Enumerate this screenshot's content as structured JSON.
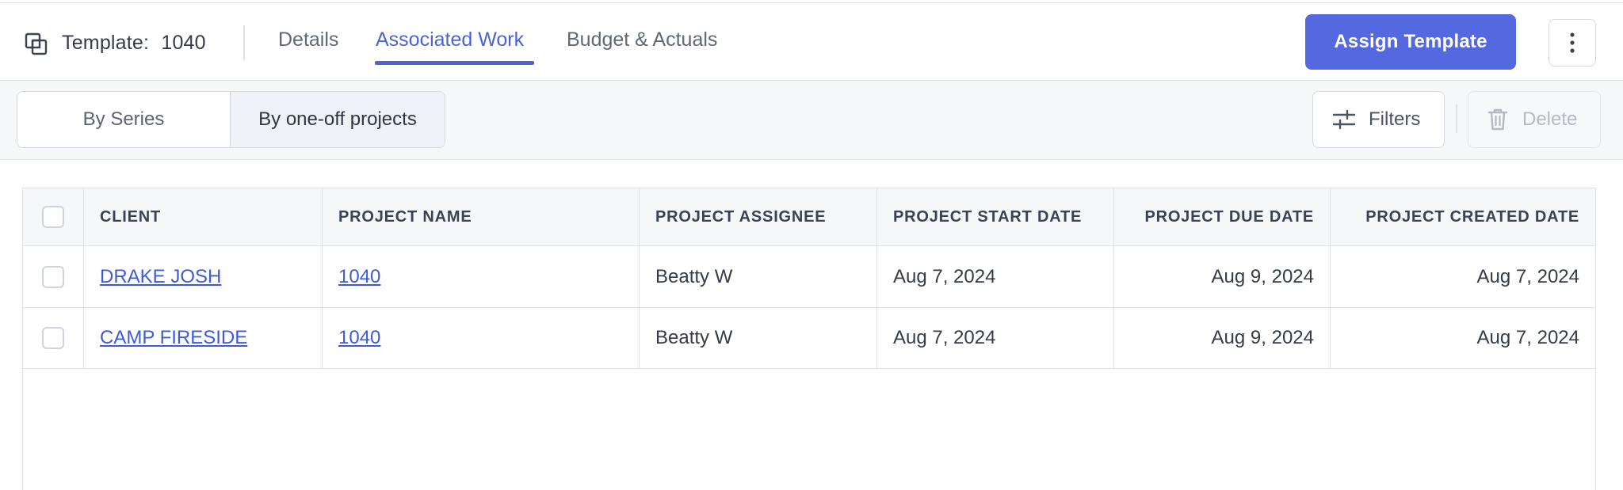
{
  "header": {
    "template_label": "Template:",
    "template_name": "1040",
    "tabs": [
      {
        "label": "Details"
      },
      {
        "label": "Associated Work"
      },
      {
        "label": "Budget & Actuals"
      }
    ],
    "active_tab": "Associated Work",
    "assign_button": "Assign Template",
    "more_icon": "more-vertical-icon",
    "template_icon": "copy-icon"
  },
  "toolbar": {
    "segments": [
      {
        "label": "By Series"
      },
      {
        "label": "By one-off projects"
      }
    ],
    "active_segment": "By one-off projects",
    "filters_label": "Filters",
    "filters_icon": "sliders-icon",
    "delete_label": "Delete",
    "delete_icon": "trash-icon"
  },
  "table": {
    "columns": [
      "CLIENT",
      "PROJECT NAME",
      "PROJECT ASSIGNEE",
      "PROJECT START DATE",
      "PROJECT DUE DATE",
      "PROJECT CREATED DATE"
    ],
    "rows": [
      {
        "client": "DRAKE JOSH",
        "project": "1040",
        "assignee": "Beatty W",
        "start": "Aug 7, 2024",
        "due": "Aug 9, 2024",
        "created": "Aug 7, 2024"
      },
      {
        "client": "CAMP FIRESIDE",
        "project": "1040",
        "assignee": "Beatty W",
        "start": "Aug 7, 2024",
        "due": "Aug 9, 2024",
        "created": "Aug 7, 2024"
      }
    ]
  },
  "colors": {
    "accent": "#4b63d9",
    "primary_button": "#5469e0",
    "link": "#3d5bd9",
    "border": "#dfe3e8",
    "toolbar_bg": "#f5f7f9"
  }
}
